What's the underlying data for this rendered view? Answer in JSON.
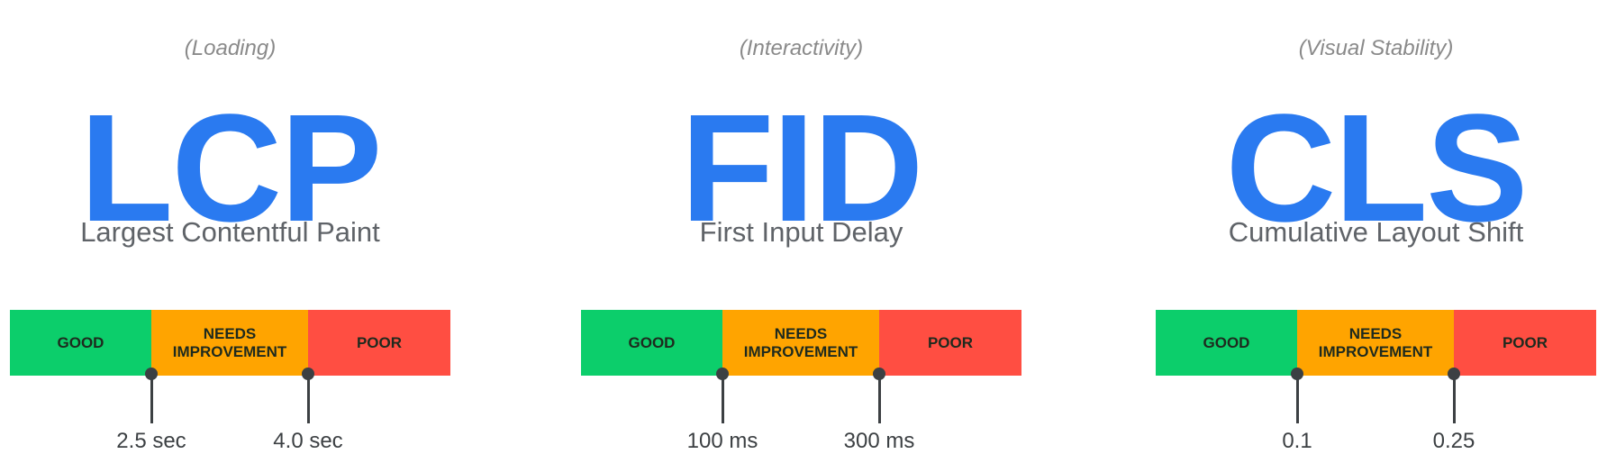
{
  "colors": {
    "good": "#0cce6b",
    "needs_improvement": "#ffa400",
    "poor": "#ff4e42",
    "accent": "#2a7af0"
  },
  "segments": {
    "good": "GOOD",
    "needs_improvement": "NEEDS IMPROVEMENT",
    "poor": "POOR"
  },
  "metrics": [
    {
      "category": "(Loading)",
      "abbr": "LCP",
      "name": "Largest Contentful Paint",
      "thresholds": [
        "2.5 sec",
        "4.0 sec"
      ]
    },
    {
      "category": "(Interactivity)",
      "abbr": "FID",
      "name": "First Input Delay",
      "thresholds": [
        "100 ms",
        "300 ms"
      ]
    },
    {
      "category": "(Visual Stability)",
      "abbr": "CLS",
      "name": "Cumulative Layout Shift",
      "thresholds": [
        "0.1",
        "0.25"
      ]
    }
  ]
}
